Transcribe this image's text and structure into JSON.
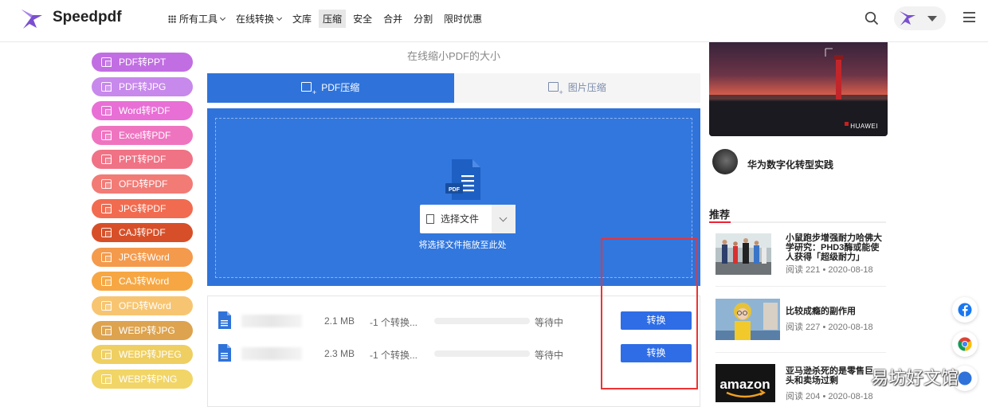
{
  "header": {
    "brand": "Speedpdf",
    "nav": [
      {
        "label": "所有工具",
        "has_grid": true,
        "has_chevron": true,
        "active": false
      },
      {
        "label": "在线转换",
        "has_grid": false,
        "has_chevron": true,
        "active": false
      },
      {
        "label": "文库",
        "active": false
      },
      {
        "label": "压缩",
        "active": true
      },
      {
        "label": "安全",
        "active": false
      },
      {
        "label": "合并",
        "active": false
      },
      {
        "label": "分割",
        "active": false
      },
      {
        "label": "限时优惠",
        "active": false
      }
    ]
  },
  "sidebar": {
    "items": [
      {
        "label": "PDF转PPT",
        "color": "#c26ee3"
      },
      {
        "label": "PDF转JPG",
        "color": "#c789eb"
      },
      {
        "label": "Word转PDF",
        "color": "#e86fd5"
      },
      {
        "label": "Excel转PDF",
        "color": "#ef74c0"
      },
      {
        "label": "PPT转PDF",
        "color": "#f07285"
      },
      {
        "label": "OFD转PDF",
        "color": "#f27b76"
      },
      {
        "label": "JPG转PDF",
        "color": "#f16b50"
      },
      {
        "label": "CAJ转PDF",
        "color": "#d74f28"
      },
      {
        "label": "JPG转Word",
        "color": "#f49a4c"
      },
      {
        "label": "CAJ转Word",
        "color": "#f6a743"
      },
      {
        "label": "OFD转Word",
        "color": "#f7c571"
      },
      {
        "label": "WEBP转JPG",
        "color": "#dda34e"
      },
      {
        "label": "WEBP转JPEG",
        "color": "#efcf62"
      },
      {
        "label": "WEBP转PNG",
        "color": "#f1d567"
      }
    ]
  },
  "main": {
    "subtitle": "在线缩小PDF的大小",
    "tabs": [
      {
        "label": "PDF压缩",
        "active": true
      },
      {
        "label": "图片压缩",
        "active": false
      }
    ],
    "dropzone": {
      "icon_label": "PDF",
      "select_label": "选择文件",
      "hint": "将选择文件拖放至此处"
    },
    "files": [
      {
        "size": "2.1 MB",
        "status": "-1 个转换...",
        "progress": 0,
        "wait": "等待中",
        "button": "转换"
      },
      {
        "size": "2.3 MB",
        "status": "-1 个转换...",
        "progress": 0,
        "wait": "等待中",
        "button": "转换"
      }
    ]
  },
  "right": {
    "banner_brand": "HUAWEI",
    "author_title": "华为数字化转型实践",
    "section_title": "推荐",
    "articles": [
      {
        "title": "小鼠跑步增强耐力哈佛大学研究：PHD3酶或能使人获得「超级耐力」",
        "reads": "阅读 221",
        "date": "2020-08-18"
      },
      {
        "title": "比较成瘾的副作用",
        "reads": "阅读 227",
        "date": "2020-08-18"
      },
      {
        "title": "亚马逊杀死的是零售巨头和卖场过剩",
        "reads": "阅读 204",
        "date": "2020-08-18",
        "thumb_text": "amazon"
      }
    ]
  },
  "watermark": "易坊好文馆",
  "colors": {
    "primary": "#2f73da",
    "button": "#2f6de6",
    "highlight_box": "#e33333"
  }
}
